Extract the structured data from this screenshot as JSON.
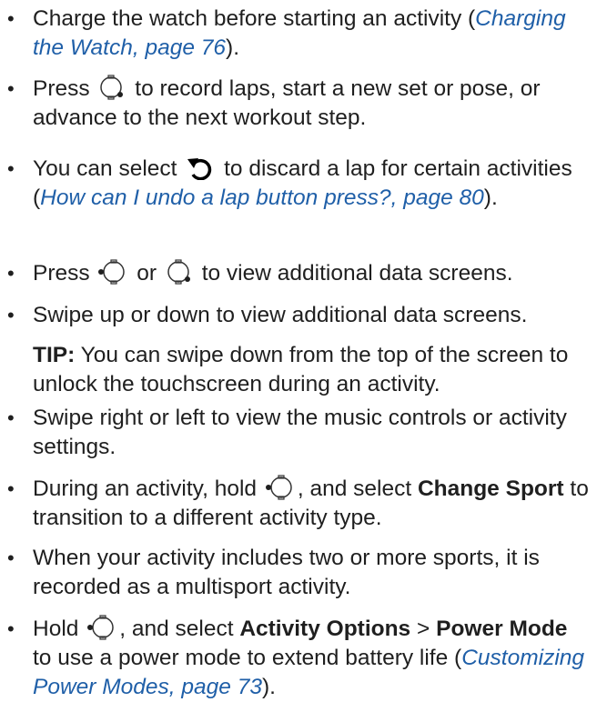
{
  "items": [
    {
      "pre": "Charge the watch before starting an activity (",
      "link": "Charging the Watch, page 76",
      "post": ")."
    },
    {
      "pre": "Press",
      "icon": "watch-button-lower-right-icon",
      "post": "to record laps, start a new set or pose, or advance to the next workout step."
    },
    {
      "pre": "You can select",
      "icon": "undo-arrow-icon",
      "mid": "to discard a lap for certain activities (",
      "link": "How can I undo a lap button press?, page 80",
      "post": ")."
    },
    {
      "pre": "Press",
      "icon1": "watch-button-left-icon",
      "or": "or",
      "icon2": "watch-button-lower-right-icon",
      "post": "to view additional data screens."
    },
    {
      "text": "Swipe up or down to view additional data screens.",
      "tip_label": "TIP:",
      "tip_text": "You can swipe down from the top of the screen to unlock the touchscreen during an activity."
    },
    {
      "text": "Swipe right or left to view the music controls or activity settings."
    },
    {
      "pre": "During an activity, hold",
      "icon": "watch-button-left-icon",
      "mid": ", and select",
      "bold": "Change Sport",
      "post": "to transition to a different activity type."
    },
    {
      "text": "When your activity includes two or more sports, it is recorded as a multisport activity."
    },
    {
      "pre": "Hold",
      "icon": "watch-button-left-icon",
      "mid": ", and select",
      "bold1": "Activity Options",
      "sep": ">",
      "bold2": "Power Mode",
      "post": "to use a power mode to extend battery life (",
      "link": "Customizing Power Modes, page 73",
      "end": ")."
    }
  ],
  "bullet": "•",
  "colors": {
    "text": "#1f1f1f",
    "link": "#1f5fa8"
  }
}
